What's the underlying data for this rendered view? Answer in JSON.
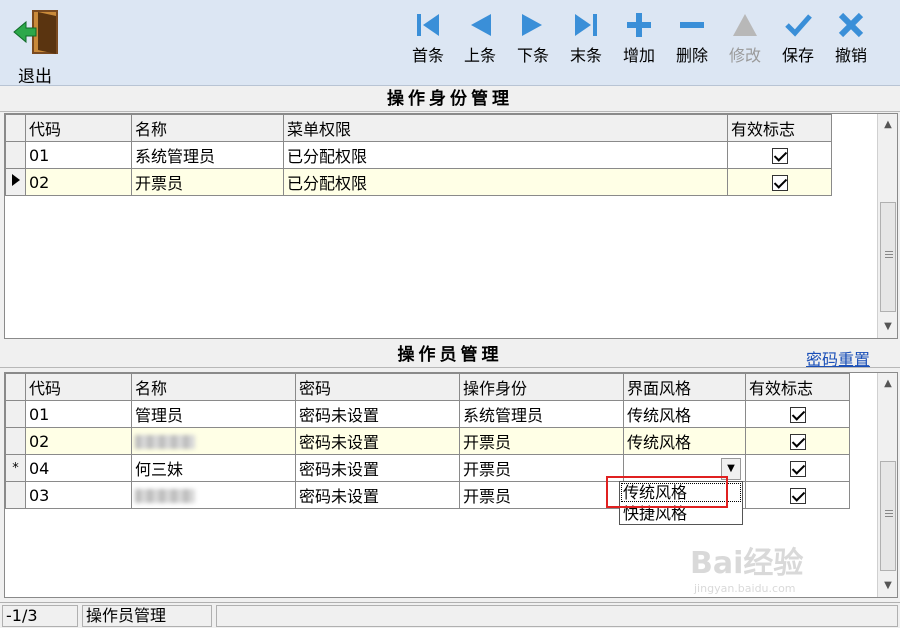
{
  "toolbar": {
    "exit_label": "退出",
    "buttons": [
      {
        "label": "首条",
        "icon": "first-record-icon"
      },
      {
        "label": "上条",
        "icon": "previous-record-icon"
      },
      {
        "label": "下条",
        "icon": "next-record-icon"
      },
      {
        "label": "末条",
        "icon": "last-record-icon"
      },
      {
        "label": "增加",
        "icon": "add-icon"
      },
      {
        "label": "删除",
        "icon": "delete-icon"
      },
      {
        "label": "修改",
        "icon": "edit-icon",
        "disabled": true
      },
      {
        "label": "保存",
        "icon": "save-check-icon"
      },
      {
        "label": "撤销",
        "icon": "cancel-x-icon"
      }
    ],
    "accent_color": "#3a8fd8"
  },
  "role_section": {
    "title": "操作身份管理",
    "columns": [
      "代码",
      "名称",
      "菜单权限",
      "有效标志"
    ],
    "rows": [
      {
        "code": "01",
        "name": "系统管理员",
        "permission": "已分配权限",
        "valid": true
      },
      {
        "code": "02",
        "name": "开票员",
        "permission": "已分配权限",
        "valid": true,
        "selected": true
      }
    ]
  },
  "operator_section": {
    "title": "操作员管理",
    "reset_link": "密码重置",
    "columns": [
      "代码",
      "名称",
      "密码",
      "操作身份",
      "界面风格",
      "有效标志"
    ],
    "rows": [
      {
        "code": "01",
        "name": "管理员",
        "password": "密码未设置",
        "role": "系统管理员",
        "style": "传统风格",
        "valid": true
      },
      {
        "code": "02",
        "name": "",
        "password": "密码未设置",
        "role": "开票员",
        "style": "传统风格",
        "valid": true,
        "selected": true,
        "name_blurred": true
      },
      {
        "code": "04",
        "name": "何三妹",
        "password": "密码未设置",
        "role": "开票员",
        "style": "",
        "valid": true,
        "editing": true,
        "indicator": "*"
      },
      {
        "code": "03",
        "name": "",
        "password": "密码未设置",
        "role": "开票员",
        "style": "",
        "valid": true,
        "name_blurred": true
      }
    ],
    "dropdown_options": [
      "传统风格",
      "快捷风格"
    ]
  },
  "status": {
    "position": "-1/3",
    "module": "操作员管理"
  },
  "watermark": {
    "text": "Bai经验",
    "sub": "jingyan.baidu.com"
  }
}
